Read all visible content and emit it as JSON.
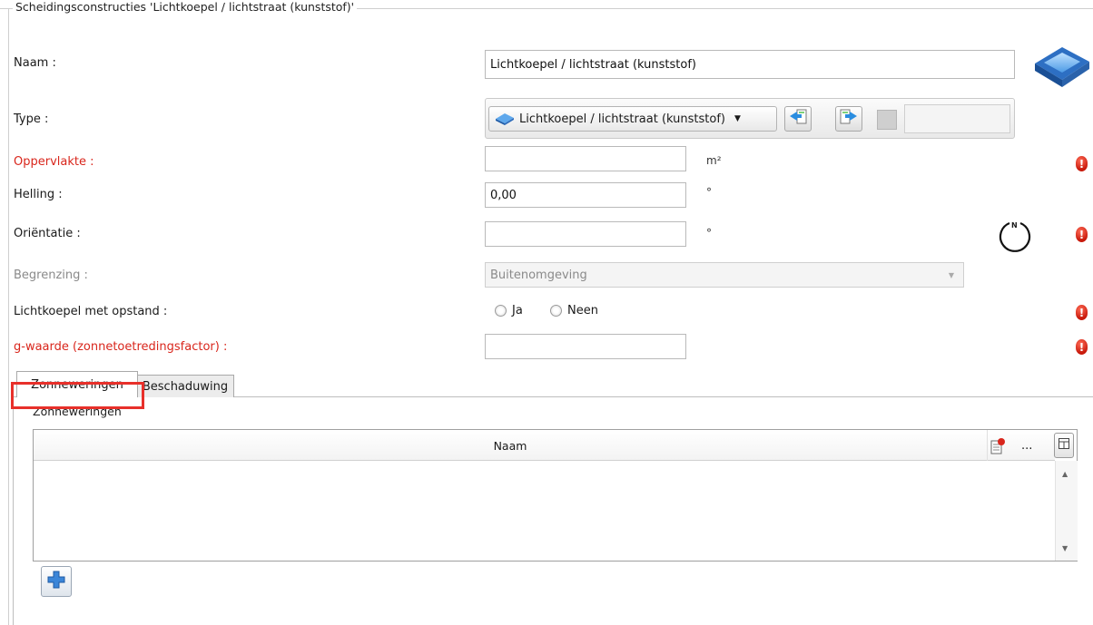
{
  "group": {
    "title": "Scheidingsconstructies 'Lichtkoepel / lichtstraat (kunststof)'"
  },
  "fields": {
    "naam": {
      "label": "Naam :",
      "value": "Lichtkoepel / lichtstraat (kunststof)"
    },
    "type": {
      "label": "Type :",
      "selected": "Lichtkoepel / lichtstraat (kunststof)",
      "extra_value": ""
    },
    "oppervlakte": {
      "label": "Oppervlakte :",
      "value": "",
      "unit": "m²"
    },
    "helling": {
      "label": "Helling :",
      "value": "0,00",
      "unit": "°"
    },
    "orientatie": {
      "label": "Oriëntatie :",
      "value": "",
      "unit": "°",
      "compass_letter": "N"
    },
    "begrenzing": {
      "label": "Begrenzing :",
      "selected": "Buitenomgeving"
    },
    "opstand": {
      "label": "Lichtkoepel met opstand :",
      "option_ja": "Ja",
      "option_neen": "Neen"
    },
    "gwaarde": {
      "label": "g-waarde (zonnetoetredingsfactor) :",
      "value": ""
    }
  },
  "error_icon_glyph": "!",
  "tabs": [
    {
      "label": "Zonneweringen",
      "active": true
    },
    {
      "label": "Beschaduwing",
      "active": false
    }
  ],
  "zonneweringen": {
    "group_title": "Zonneweringen",
    "columns": [
      "Naam"
    ],
    "more_label": "...",
    "rows": []
  },
  "colors": {
    "error": "#d9261c",
    "highlight": "#e8302a",
    "accent_blue": "#2d73c9"
  }
}
